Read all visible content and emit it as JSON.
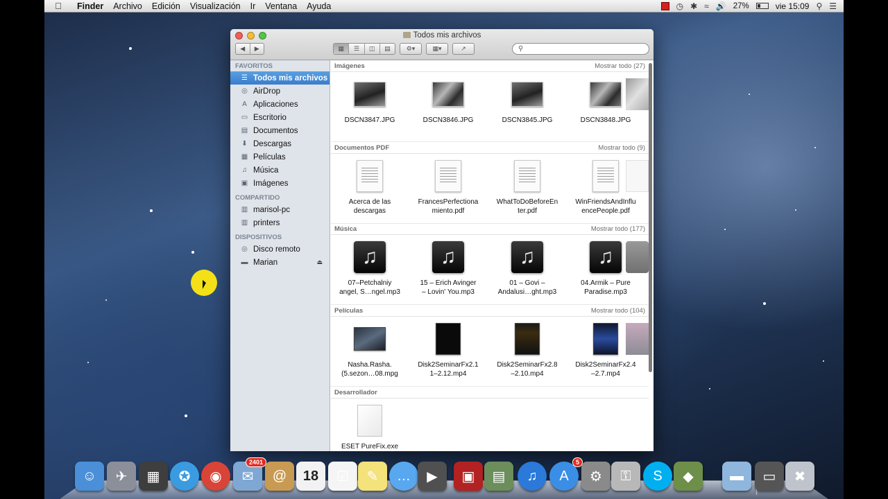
{
  "menubar": {
    "app_name": "Finder",
    "menus": [
      "Archivo",
      "Edición",
      "Visualización",
      "Ir",
      "Ventana",
      "Ayuda"
    ],
    "battery_percent": "27%",
    "clock": "vie 15:09"
  },
  "window": {
    "title": "Todos mis archivos",
    "search_placeholder": ""
  },
  "sidebar": {
    "sections": [
      {
        "heading": "FAVORITOS",
        "items": [
          {
            "label": "Todos mis archivos",
            "icon": "all-files-icon",
            "selected": true
          },
          {
            "label": "AirDrop",
            "icon": "airdrop-icon"
          },
          {
            "label": "Aplicaciones",
            "icon": "applications-icon"
          },
          {
            "label": "Escritorio",
            "icon": "desktop-icon"
          },
          {
            "label": "Documentos",
            "icon": "documents-icon"
          },
          {
            "label": "Descargas",
            "icon": "downloads-icon"
          },
          {
            "label": "Películas",
            "icon": "movies-icon"
          },
          {
            "label": "Música",
            "icon": "music-icon"
          },
          {
            "label": "Imágenes",
            "icon": "pictures-icon"
          }
        ]
      },
      {
        "heading": "COMPARTIDO",
        "items": [
          {
            "label": "marisol-pc",
            "icon": "pc-icon"
          },
          {
            "label": "printers",
            "icon": "pc-icon"
          }
        ]
      },
      {
        "heading": "DISPOSITIVOS",
        "items": [
          {
            "label": "Disco remoto",
            "icon": "disc-icon"
          },
          {
            "label": "Marian",
            "icon": "drive-icon",
            "eject": true
          }
        ]
      }
    ]
  },
  "sections": [
    {
      "title": "Imágenes",
      "more": "Mostrar todo (27)",
      "items": [
        {
          "label": "DSCN3847.JPG",
          "kind": "photo"
        },
        {
          "label": "DSCN3846.JPG",
          "kind": "photo"
        },
        {
          "label": "DSCN3845.JPG",
          "kind": "photo"
        },
        {
          "label": "DSCN3848.JPG",
          "kind": "photo"
        }
      ]
    },
    {
      "title": "Documentos PDF",
      "more": "Mostrar todo (9)",
      "items": [
        {
          "label": "Acerca de las descargas",
          "kind": "pdf"
        },
        {
          "label": "FrancesPerfectionamiento.pdf",
          "label_lines": [
            "FrancesPerfectiona",
            "miento.pdf"
          ],
          "kind": "pdf"
        },
        {
          "label": "WhatToDoBeforeEnter.pdf",
          "label_lines": [
            "WhatToDoBeforeEn",
            "ter.pdf"
          ],
          "kind": "pdf"
        },
        {
          "label": "WinFriendsAndInfluencePeople.pdf",
          "label_lines": [
            "WinFriendsAndInflu",
            "encePeople.pdf"
          ],
          "kind": "pdf"
        }
      ]
    },
    {
      "title": "Música",
      "more": "Mostrar todo (177)",
      "items": [
        {
          "label_lines": [
            "07–Petchalniy",
            "angel, S…ngel.mp3"
          ],
          "kind": "music"
        },
        {
          "label_lines": [
            "15 – Erich Avinger",
            "– Lovin' You.mp3"
          ],
          "kind": "music"
        },
        {
          "label_lines": [
            "01 – Govi –",
            "Andalusi…ght.mp3"
          ],
          "kind": "music"
        },
        {
          "label_lines": [
            "04.Armik – Pure",
            "Paradise.mp3"
          ],
          "kind": "music"
        }
      ]
    },
    {
      "title": "Películas",
      "more": "Mostrar todo (104)",
      "items": [
        {
          "label_lines": [
            "Nasha.Rasha.",
            "(5.sezon…08.mpg"
          ],
          "kind": "video-wide"
        },
        {
          "label_lines": [
            "Disk2SeminarFx2.1",
            "1–2.12.mp4"
          ],
          "kind": "video"
        },
        {
          "label_lines": [
            "Disk2SeminarFx2.8",
            "–2.10.mp4"
          ],
          "kind": "video-gold"
        },
        {
          "label_lines": [
            "Disk2SeminarFx2.4",
            "–2.7.mp4"
          ],
          "kind": "video-blue"
        }
      ]
    },
    {
      "title": "Desarrollador",
      "more": "",
      "items": [
        {
          "label_lines": [
            "ESET PureFix.exe"
          ],
          "kind": "doc"
        }
      ]
    }
  ],
  "dock": {
    "items": [
      {
        "name": "finder-icon",
        "color": "#4a8fd8"
      },
      {
        "name": "launchpad-icon",
        "color": "#8a8f9a"
      },
      {
        "name": "mission-control-icon",
        "color": "#3e3e3e"
      },
      {
        "name": "safari-icon",
        "color": "#3a9be0"
      },
      {
        "name": "chrome-icon",
        "color": "#d84437"
      },
      {
        "name": "mail-icon",
        "color": "#7fa7d4",
        "badge": "2401"
      },
      {
        "name": "contacts-icon",
        "color": "#c89a52"
      },
      {
        "name": "calendar-icon",
        "color": "#f2f2f2",
        "text": "18"
      },
      {
        "name": "reminders-icon",
        "color": "#f5f5f5"
      },
      {
        "name": "notes-icon",
        "color": "#f4e27a"
      },
      {
        "name": "messages-icon",
        "color": "#58a8f0"
      },
      {
        "name": "facetime-icon",
        "color": "#505050"
      },
      {
        "name": "photo-booth-icon",
        "color": "#b22222"
      },
      {
        "name": "iphoto-icon",
        "color": "#6b8e5a"
      },
      {
        "name": "itunes-icon",
        "color": "#2b79d9"
      },
      {
        "name": "app-store-icon",
        "color": "#3b8ee6",
        "badge": "5"
      },
      {
        "name": "system-preferences-icon",
        "color": "#8a8a8a"
      },
      {
        "name": "keychain-icon",
        "color": "#b8b8b8"
      },
      {
        "name": "skype-icon",
        "color": "#00aff0"
      },
      {
        "name": "utility-app-icon",
        "color": "#6d8f4a"
      },
      {
        "name": "applications-folder-icon",
        "color": "#8fb6dc"
      },
      {
        "name": "downloads-stack-icon",
        "color": "#555"
      },
      {
        "name": "trash-icon",
        "color": "#bfc4cc"
      }
    ]
  }
}
